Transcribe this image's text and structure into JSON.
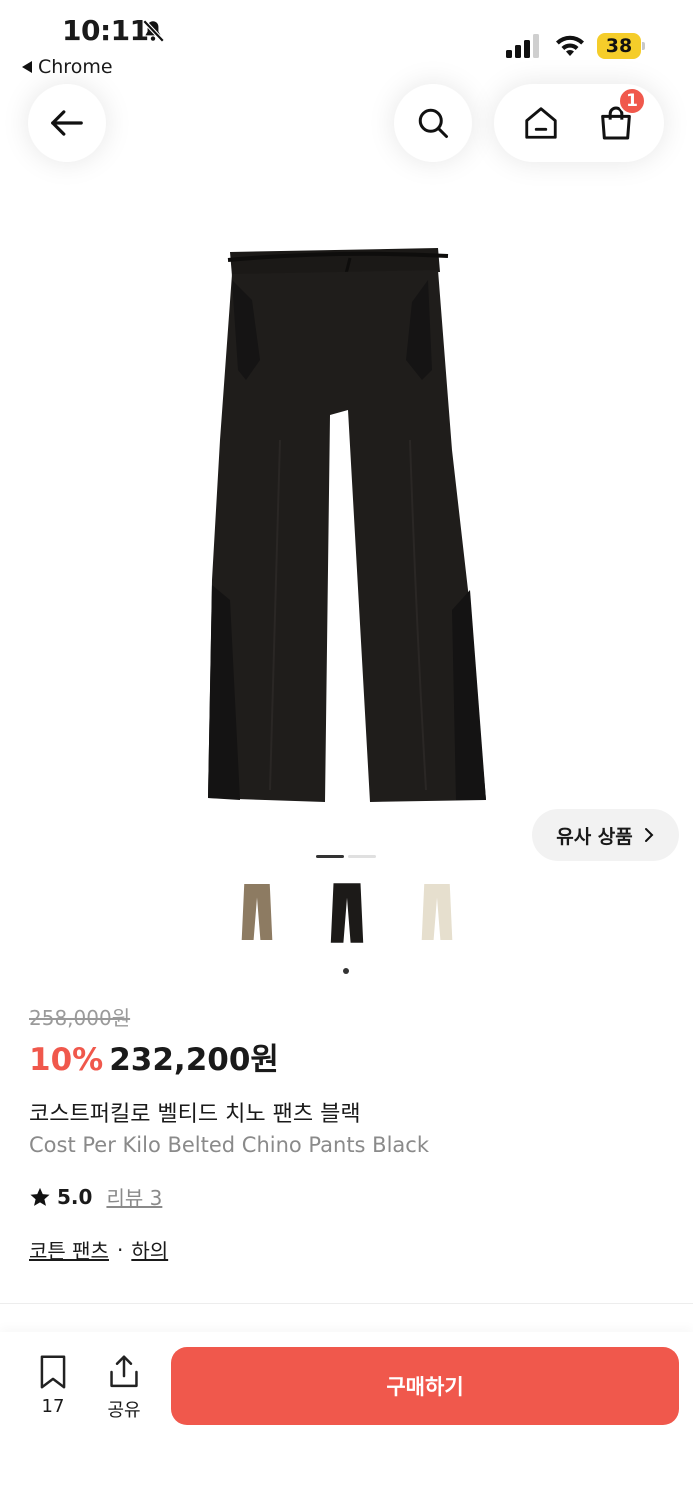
{
  "status_bar": {
    "time": "10:11",
    "back_app": "Chrome",
    "battery": "38"
  },
  "nav": {
    "cart_count": "1"
  },
  "gallery": {
    "similar_label": "유사 상품"
  },
  "product": {
    "original_price": "258,000원",
    "discount": "10%",
    "sale_price": "232,200원",
    "title_ko": "코스트퍼킬로 벨티드 치노 팬츠 블랙",
    "title_en": "Cost Per Kilo Belted Chino Pants Black",
    "rating": "5.0",
    "reviews": "리뷰 3",
    "category_1": "코튼 팬츠",
    "category_sep": "·",
    "category_2": "하의"
  },
  "bottom_bar": {
    "bookmark_count": "17",
    "share_label": "공유",
    "buy_label": "구매하기"
  },
  "colors": {
    "accent": "#f0584c",
    "battery": "#f5cd2a"
  }
}
